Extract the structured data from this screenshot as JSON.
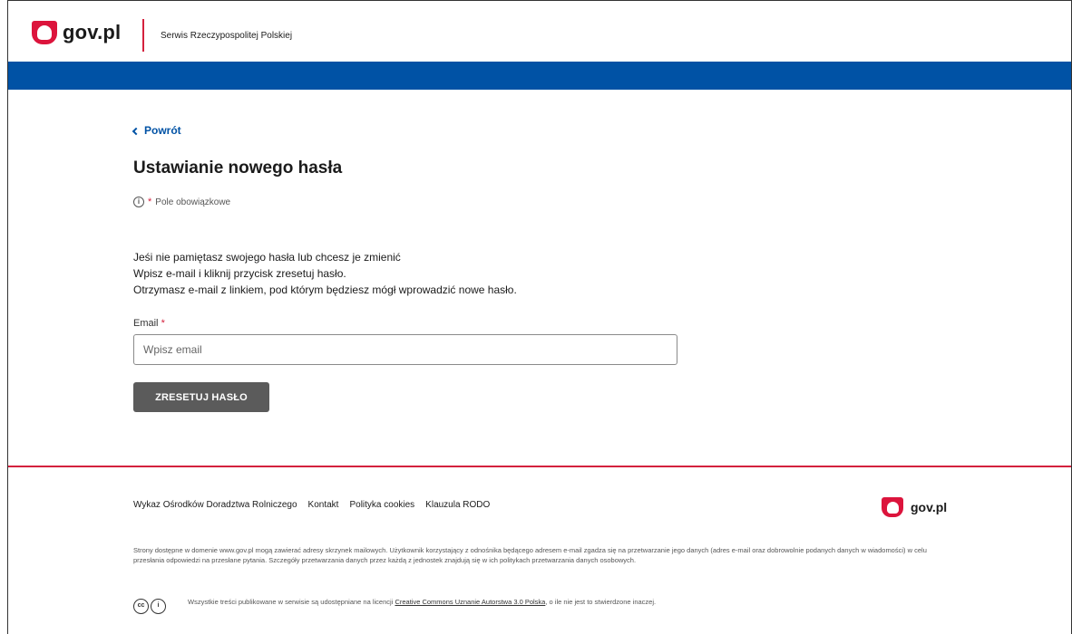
{
  "header": {
    "logo_text": "gov.pl",
    "service_name": "Serwis Rzeczypospolitej Polskiej"
  },
  "main": {
    "back_label": "Powrót",
    "title": "Ustawianie nowego hasła",
    "required_star": "*",
    "required_note": "Pole obowiązkowe",
    "description": [
      "Jeśi nie pamiętasz swojego hasła lub chcesz je zmienić",
      "Wpisz e-mail i kliknij przycisk zresetuj hasło.",
      "Otrzymasz e-mail z linkiem, pod którym będziesz mógł wprowadzić nowe hasło."
    ],
    "email_label": "Email",
    "email_placeholder": "Wpisz email",
    "email_value": "",
    "reset_button": "ZRESETUJ HASŁO"
  },
  "footer": {
    "links": [
      "Wykaz Ośrodków Doradztwa Rolniczego",
      "Kontakt",
      "Polityka cookies",
      "Klauzula RODO"
    ],
    "logo_text": "gov.pl",
    "disclaimer": "Strony dostępne w domenie www.gov.pl mogą zawierać adresy skrzynek mailowych. Użytkownik korzystający z odnośnika będącego adresem e-mail zgadza się na przetwarzanie jego danych (adres e-mail oraz dobrowolnie podanych danych w wiadomości) w celu przesłania odpowiedzi na przesłane pytania. Szczegóły przetwarzania danych przez każdą z jednostek znajdują się w ich politykach przetwarzania danych osobowych.",
    "license_prefix": "Wszystkie treści publikowane w serwisie są udostępniane na licencji ",
    "license_link": "Creative Commons Uznanie Autorstwa 3.0 Polska",
    "license_suffix": ", o ile nie jest to stwierdzone inaczej.",
    "cc_icon_1": "cc",
    "cc_icon_2": "i"
  },
  "colors": {
    "gov_red": "#dc143c",
    "gov_blue": "#0052a5",
    "button_gray": "#5b5b5b"
  }
}
